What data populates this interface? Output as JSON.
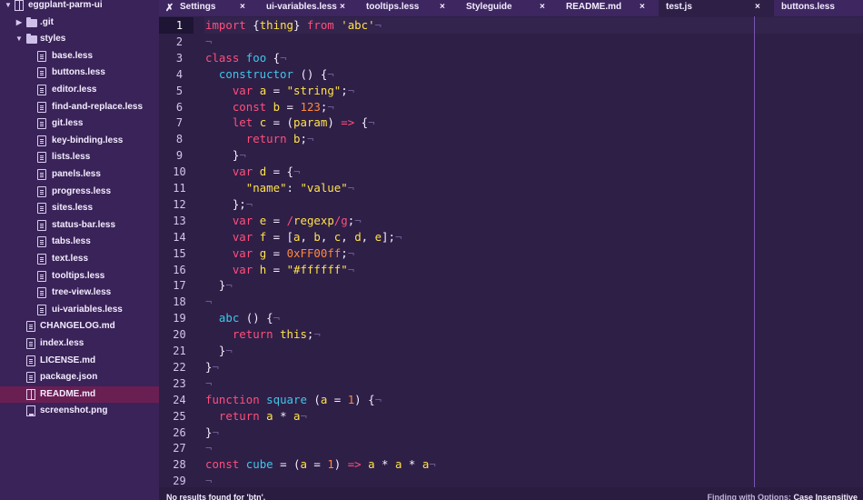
{
  "tree": {
    "items": [
      {
        "label": "eggplant-parm-ui",
        "type": "root",
        "depth": 0
      },
      {
        "label": ".git",
        "type": "folder-collapsed",
        "depth": 1
      },
      {
        "label": "styles",
        "type": "folder-open",
        "depth": 1
      },
      {
        "label": "base.less",
        "type": "file",
        "depth": 2
      },
      {
        "label": "buttons.less",
        "type": "file",
        "depth": 2
      },
      {
        "label": "editor.less",
        "type": "file",
        "depth": 2
      },
      {
        "label": "find-and-replace.less",
        "type": "file",
        "depth": 2
      },
      {
        "label": "git.less",
        "type": "file",
        "depth": 2
      },
      {
        "label": "key-binding.less",
        "type": "file",
        "depth": 2
      },
      {
        "label": "lists.less",
        "type": "file",
        "depth": 2
      },
      {
        "label": "panels.less",
        "type": "file",
        "depth": 2
      },
      {
        "label": "progress.less",
        "type": "file",
        "depth": 2
      },
      {
        "label": "sites.less",
        "type": "file",
        "depth": 2
      },
      {
        "label": "status-bar.less",
        "type": "file",
        "depth": 2
      },
      {
        "label": "tabs.less",
        "type": "file",
        "depth": 2
      },
      {
        "label": "text.less",
        "type": "file",
        "depth": 2
      },
      {
        "label": "tooltips.less",
        "type": "file",
        "depth": 2
      },
      {
        "label": "tree-view.less",
        "type": "file",
        "depth": 2
      },
      {
        "label": "ui-variables.less",
        "type": "file",
        "depth": 2
      },
      {
        "label": "CHANGELOG.md",
        "type": "file",
        "depth": 1
      },
      {
        "label": "index.less",
        "type": "file",
        "depth": 1
      },
      {
        "label": "LICENSE.md",
        "type": "file",
        "depth": 1
      },
      {
        "label": "package.json",
        "type": "file",
        "depth": 1
      },
      {
        "label": "README.md",
        "type": "book",
        "depth": 1,
        "selected": true
      },
      {
        "label": "screenshot.png",
        "type": "image",
        "depth": 1
      }
    ]
  },
  "tabs": [
    {
      "label": "Settings",
      "icon": "tools-icon",
      "close": "×",
      "active": false
    },
    {
      "label": "ui-variables.less",
      "close": "×",
      "active": false
    },
    {
      "label": "tooltips.less",
      "close": "×",
      "active": false
    },
    {
      "label": "Styleguide",
      "close": "×",
      "active": false
    },
    {
      "label": "README.md",
      "close": "×",
      "active": false
    },
    {
      "label": "test.js",
      "close": "×",
      "active": true
    },
    {
      "label": "buttons.less",
      "close": "",
      "active": false
    }
  ],
  "editor": {
    "current_line": 1,
    "lines": [
      [
        [
          "t-kw",
          "import"
        ],
        [
          "t-plain",
          " {"
        ],
        [
          "t-var",
          "thing"
        ],
        [
          "t-plain",
          "} "
        ],
        [
          "t-kw",
          "from"
        ],
        [
          "t-plain",
          " "
        ],
        [
          "t-str",
          "'abc'"
        ],
        [
          "t-inv",
          "¬"
        ]
      ],
      [
        [
          "t-inv",
          "¬"
        ]
      ],
      [
        [
          "t-kw",
          "class"
        ],
        [
          "t-plain",
          " "
        ],
        [
          "t-fn",
          "foo"
        ],
        [
          "t-plain",
          " {"
        ],
        [
          "t-inv",
          "¬"
        ]
      ],
      [
        [
          "t-plain",
          "  "
        ],
        [
          "t-fn",
          "constructor"
        ],
        [
          "t-plain",
          " () {"
        ],
        [
          "t-inv",
          "¬"
        ]
      ],
      [
        [
          "t-plain",
          "    "
        ],
        [
          "t-kw",
          "var"
        ],
        [
          "t-plain",
          " "
        ],
        [
          "t-var",
          "a"
        ],
        [
          "t-plain",
          " = "
        ],
        [
          "t-str",
          "\"string\""
        ],
        [
          "t-plain",
          ";"
        ],
        [
          "t-inv",
          "¬"
        ]
      ],
      [
        [
          "t-plain",
          "    "
        ],
        [
          "t-kw",
          "const"
        ],
        [
          "t-plain",
          " "
        ],
        [
          "t-var",
          "b"
        ],
        [
          "t-plain",
          " = "
        ],
        [
          "t-num",
          "123"
        ],
        [
          "t-plain",
          ";"
        ],
        [
          "t-inv",
          "¬"
        ]
      ],
      [
        [
          "t-plain",
          "    "
        ],
        [
          "t-kw",
          "let"
        ],
        [
          "t-plain",
          " "
        ],
        [
          "t-var",
          "c"
        ],
        [
          "t-plain",
          " = ("
        ],
        [
          "t-var",
          "param"
        ],
        [
          "t-plain",
          ") "
        ],
        [
          "t-op",
          "=>"
        ],
        [
          "t-plain",
          " {"
        ],
        [
          "t-inv",
          "¬"
        ]
      ],
      [
        [
          "t-plain",
          "      "
        ],
        [
          "t-kw",
          "return"
        ],
        [
          "t-plain",
          " "
        ],
        [
          "t-var",
          "b"
        ],
        [
          "t-plain",
          ";"
        ],
        [
          "t-inv",
          "¬"
        ]
      ],
      [
        [
          "t-plain",
          "    }"
        ],
        [
          "t-inv",
          "¬"
        ]
      ],
      [
        [
          "t-plain",
          "    "
        ],
        [
          "t-kw",
          "var"
        ],
        [
          "t-plain",
          " "
        ],
        [
          "t-var",
          "d"
        ],
        [
          "t-plain",
          " = {"
        ],
        [
          "t-inv",
          "¬"
        ]
      ],
      [
        [
          "t-plain",
          "      "
        ],
        [
          "t-str",
          "\"name\""
        ],
        [
          "t-plain",
          ": "
        ],
        [
          "t-str",
          "\"value\""
        ],
        [
          "t-inv",
          "¬"
        ]
      ],
      [
        [
          "t-plain",
          "    };"
        ],
        [
          "t-inv",
          "¬"
        ]
      ],
      [
        [
          "t-plain",
          "    "
        ],
        [
          "t-kw",
          "var"
        ],
        [
          "t-plain",
          " "
        ],
        [
          "t-var",
          "e"
        ],
        [
          "t-plain",
          " = "
        ],
        [
          "t-re",
          "/"
        ],
        [
          "t-str",
          "regexp"
        ],
        [
          "t-re",
          "/g"
        ],
        [
          "t-plain",
          ";"
        ],
        [
          "t-inv",
          "¬"
        ]
      ],
      [
        [
          "t-plain",
          "    "
        ],
        [
          "t-kw",
          "var"
        ],
        [
          "t-plain",
          " "
        ],
        [
          "t-var",
          "f"
        ],
        [
          "t-plain",
          " = ["
        ],
        [
          "t-var",
          "a"
        ],
        [
          "t-plain",
          ", "
        ],
        [
          "t-var",
          "b"
        ],
        [
          "t-plain",
          ", "
        ],
        [
          "t-var",
          "c"
        ],
        [
          "t-plain",
          ", "
        ],
        [
          "t-var",
          "d"
        ],
        [
          "t-plain",
          ", "
        ],
        [
          "t-var",
          "e"
        ],
        [
          "t-plain",
          "];"
        ],
        [
          "t-inv",
          "¬"
        ]
      ],
      [
        [
          "t-plain",
          "    "
        ],
        [
          "t-kw",
          "var"
        ],
        [
          "t-plain",
          " "
        ],
        [
          "t-var",
          "g"
        ],
        [
          "t-plain",
          " = "
        ],
        [
          "t-num",
          "0xFF00ff"
        ],
        [
          "t-plain",
          ";"
        ],
        [
          "t-inv",
          "¬"
        ]
      ],
      [
        [
          "t-plain",
          "    "
        ],
        [
          "t-kw",
          "var"
        ],
        [
          "t-plain",
          " "
        ],
        [
          "t-var",
          "h"
        ],
        [
          "t-plain",
          " = "
        ],
        [
          "t-str",
          "\"#ffffff\""
        ],
        [
          "t-inv",
          "¬"
        ]
      ],
      [
        [
          "t-plain",
          "  }"
        ],
        [
          "t-inv",
          "¬"
        ]
      ],
      [
        [
          "t-inv",
          "¬"
        ]
      ],
      [
        [
          "t-plain",
          "  "
        ],
        [
          "t-fn",
          "abc"
        ],
        [
          "t-plain",
          " () {"
        ],
        [
          "t-inv",
          "¬"
        ]
      ],
      [
        [
          "t-plain",
          "    "
        ],
        [
          "t-kw",
          "return"
        ],
        [
          "t-plain",
          " "
        ],
        [
          "t-this",
          "this"
        ],
        [
          "t-plain",
          ";"
        ],
        [
          "t-inv",
          "¬"
        ]
      ],
      [
        [
          "t-plain",
          "  }"
        ],
        [
          "t-inv",
          "¬"
        ]
      ],
      [
        [
          "t-plain",
          "}"
        ],
        [
          "t-inv",
          "¬"
        ]
      ],
      [
        [
          "t-inv",
          "¬"
        ]
      ],
      [
        [
          "t-kw",
          "function"
        ],
        [
          "t-plain",
          " "
        ],
        [
          "t-fn",
          "square"
        ],
        [
          "t-plain",
          " ("
        ],
        [
          "t-var",
          "a"
        ],
        [
          "t-plain",
          " = "
        ],
        [
          "t-num",
          "1"
        ],
        [
          "t-plain",
          ") {"
        ],
        [
          "t-inv",
          "¬"
        ]
      ],
      [
        [
          "t-plain",
          "  "
        ],
        [
          "t-kw",
          "return"
        ],
        [
          "t-plain",
          " "
        ],
        [
          "t-var",
          "a"
        ],
        [
          "t-plain",
          " * "
        ],
        [
          "t-var",
          "a"
        ],
        [
          "t-inv",
          "¬"
        ]
      ],
      [
        [
          "t-plain",
          "}"
        ],
        [
          "t-inv",
          "¬"
        ]
      ],
      [
        [
          "t-inv",
          "¬"
        ]
      ],
      [
        [
          "t-kw",
          "const"
        ],
        [
          "t-plain",
          " "
        ],
        [
          "t-fn",
          "cube"
        ],
        [
          "t-plain",
          " = ("
        ],
        [
          "t-var",
          "a"
        ],
        [
          "t-plain",
          " = "
        ],
        [
          "t-num",
          "1"
        ],
        [
          "t-plain",
          ") "
        ],
        [
          "t-op",
          "=>"
        ],
        [
          "t-plain",
          " "
        ],
        [
          "t-var",
          "a"
        ],
        [
          "t-plain",
          " * "
        ],
        [
          "t-var",
          "a"
        ],
        [
          "t-plain",
          " * "
        ],
        [
          "t-var",
          "a"
        ],
        [
          "t-inv",
          "¬"
        ]
      ],
      [
        [
          "t-inv",
          "¬"
        ]
      ]
    ]
  },
  "status": {
    "find_message": "No results found for 'btn'.",
    "finding_label": "Finding with Options:",
    "finding_options": "Case Insensitive"
  }
}
